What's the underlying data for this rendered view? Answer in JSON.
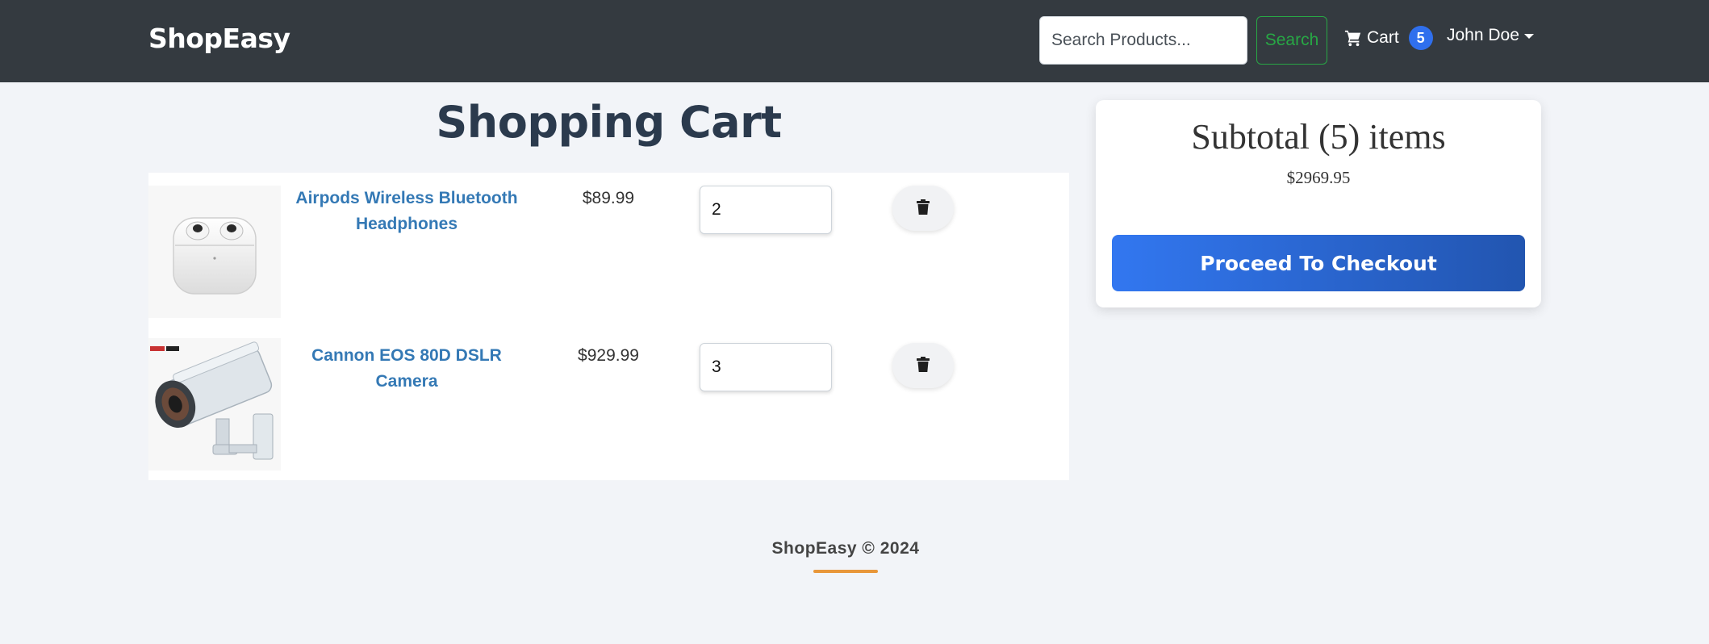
{
  "navbar": {
    "brand": "ShopEasy",
    "search": {
      "placeholder": "Search Products...",
      "value": ""
    },
    "search_button": "Search",
    "cart_label": "Cart",
    "cart_count": "5",
    "user_name": "John Doe"
  },
  "page": {
    "title": "Shopping Cart"
  },
  "cart": {
    "items": [
      {
        "name": "Airpods Wireless Bluetooth Headphones",
        "price": "$89.99",
        "quantity": "2",
        "image": "airpods"
      },
      {
        "name": "Cannon EOS 80D DSLR Camera",
        "price": "$929.99",
        "quantity": "3",
        "image": "camera"
      }
    ]
  },
  "summary": {
    "title": "Subtotal (5) items",
    "total": "$2969.95",
    "checkout_button": "Proceed To Checkout"
  },
  "footer": {
    "text": "ShopEasy © 2024"
  },
  "colors": {
    "navbar": "#343a40",
    "accent": "#3277f0",
    "link": "#3479b5",
    "success": "#28a745",
    "footer_accent": "#e8973a"
  },
  "icons": [
    "shopping-cart-icon",
    "trash-icon",
    "caret-down-icon"
  ]
}
